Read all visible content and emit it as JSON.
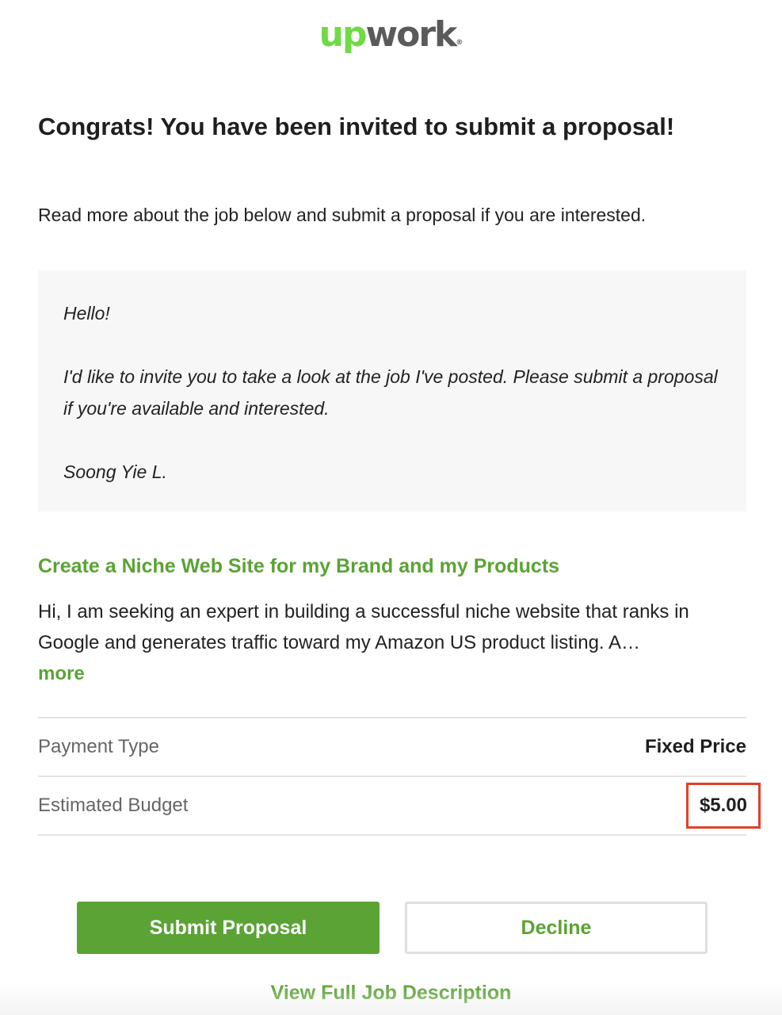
{
  "logo": {
    "up": "up",
    "work": "work",
    "mark": "®"
  },
  "headline": "Congrats! You have been invited to submit a proposal!",
  "intro": "Read more about the job below and submit a proposal if you are interested.",
  "message": {
    "greeting": "Hello!",
    "body": "I'd like to invite you to take a look at the job I've posted. Please submit a proposal if you're available and interested.",
    "signature": "Soong Yie L."
  },
  "job": {
    "title": "Create a Niche Web Site for my Brand and my Products",
    "description": "Hi, I am seeking an expert in building a successful niche website that ranks in Google and generates traffic toward my Amazon US product listing. A…",
    "more_label": "more"
  },
  "details": {
    "payment_type_label": "Payment Type",
    "payment_type_value": "Fixed Price",
    "budget_label": "Estimated Budget",
    "budget_value": "$5.00"
  },
  "actions": {
    "submit_label": "Submit Proposal",
    "decline_label": "Decline",
    "view_full_label": "View Full Job Description"
  },
  "colors": {
    "brand_green": "#5aa334",
    "logo_green": "#6fda44",
    "highlight_red": "#e0402a",
    "message_bg": "#f7f7f7"
  }
}
